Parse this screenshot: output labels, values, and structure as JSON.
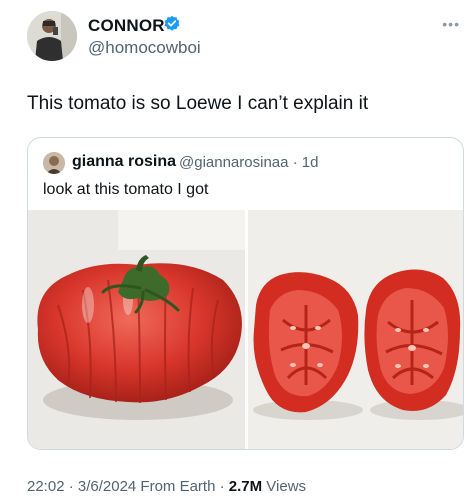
{
  "author": {
    "name": "CONNOR",
    "handle": "@homocowboi",
    "verified_color": "#1d9bf0"
  },
  "tweet": {
    "text": "This tomato is so Loewe I can’t explain it"
  },
  "quoted": {
    "name": "gianna rosina",
    "handle_time": "@giannarosinaa · 1d",
    "text": "look at this tomato I got"
  },
  "meta": {
    "datetime": "22:02 · 3/6/2024 From Earth · ",
    "views_count": "2.7M",
    "views_label": " Views"
  }
}
